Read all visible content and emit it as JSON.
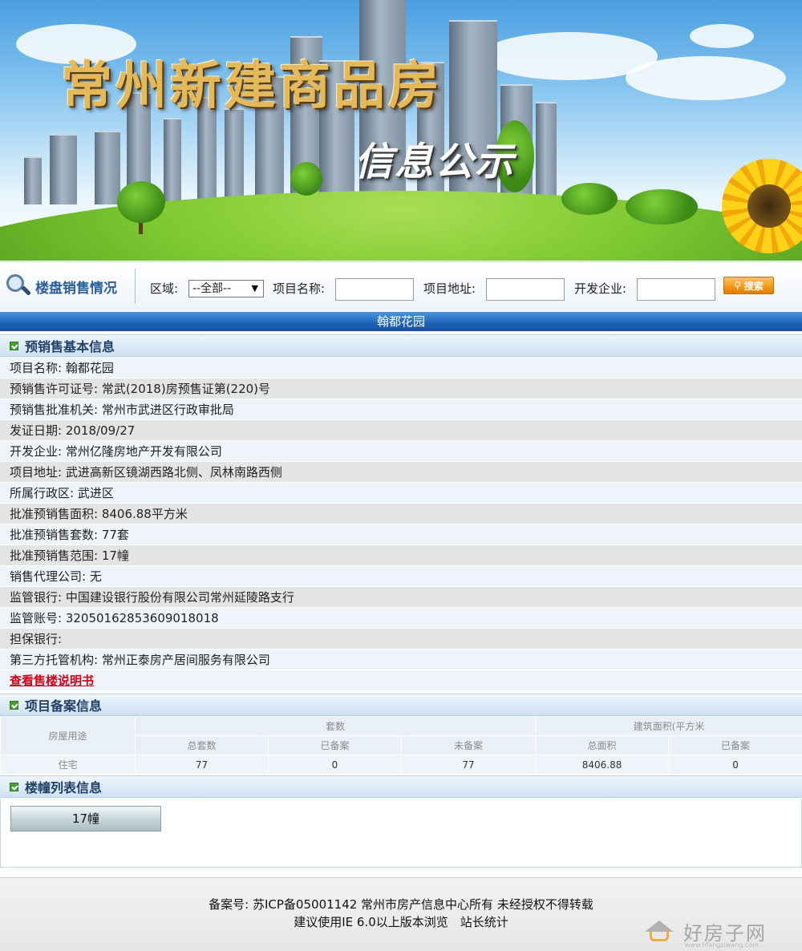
{
  "banner": {
    "title": "常州新建商品房",
    "subtitle": "信息公示"
  },
  "search": {
    "brand_label": "楼盘销售情况",
    "region_label": "区域:",
    "region_value": "--全部--",
    "project_name_label": "项目名称:",
    "project_address_label": "项目地址:",
    "developer_label": "开发企业:",
    "search_button": "搜索"
  },
  "project_title": "翰都花园",
  "sections": {
    "basic_info": "预销售基本信息",
    "record_info": "项目备案信息",
    "building_list": "楼幢列表信息"
  },
  "basic_info_rows": [
    "项目名称: 翰都花园",
    "预销售许可证号: 常武(2018)房预售证第(220)号",
    "预销售批准机关: 常州市武进区行政审批局",
    "发证日期: 2018/09/27",
    "开发企业: 常州亿隆房地产开发有限公司",
    "项目地址: 武进高新区镜湖西路北侧、凤林南路西侧",
    "所属行政区: 武进区",
    "批准预销售面积: 8406.88平方米",
    "批准预销售套数: 77套",
    "批准预销售范围: 17幢",
    "销售代理公司: 无",
    "监管银行: 中国建设银行股份有限公司常州延陵路支行",
    "监管账号: 32050162853609018018",
    "担保银行:",
    "第三方托管机构: 常州正泰房产居间服务有限公司"
  ],
  "sales_manual_link": "查看售楼说明书",
  "record_table": {
    "col_usage": "房屋用途",
    "group_units": "套数",
    "group_area": "建筑面积(平方米",
    "sub_total_units": "总套数",
    "sub_recorded_units": "已备案",
    "sub_unrecorded_units": "未备案",
    "sub_total_area": "总面积",
    "sub_recorded_area": "已备案",
    "row": {
      "usage": "住宅",
      "total_units": "77",
      "recorded_units": "0",
      "unrecorded_units": "77",
      "total_area": "8406.88",
      "recorded_area": "0"
    }
  },
  "buildings": [
    "17幢"
  ],
  "footer": {
    "line1": "备案号: 苏ICP备05001142 常州市房产信息中心所有 未经授权不得转载",
    "line2": "建议使用IE 6.0以上版本浏览　站长统计"
  },
  "watermark": {
    "text": "好房子网",
    "url": "www.hfangziwang.com"
  }
}
